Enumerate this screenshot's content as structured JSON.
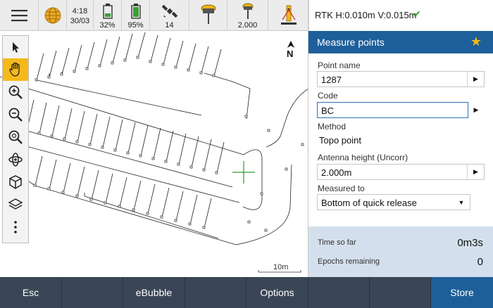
{
  "statusbar": {
    "menu_icon": "hamburger-menu-icon",
    "time": "4:18",
    "date": "30/03",
    "battery1": "32%",
    "battery2": "95%",
    "satellites": "14",
    "target_height": "2.000",
    "rtk": "RTK H:0.010m V:0.015m",
    "rtk_status_color": "#3aa035"
  },
  "map": {
    "north_label": "N",
    "scale_label": "10m",
    "tools": [
      "select-arrow-icon",
      "pan-hand-icon",
      "zoom-in-icon",
      "zoom-out-icon",
      "zoom-extents-icon",
      "orbit-icon",
      "cube-view-icon",
      "layers-icon",
      "more-dots-icon"
    ]
  },
  "panel": {
    "title": "Measure points",
    "point_name_label": "Point name",
    "point_name_value": "1287",
    "code_label": "Code",
    "code_value": "BC",
    "method_label": "Method",
    "method_value": "Topo point",
    "antenna_label": "Antenna height (Uncorr)",
    "antenna_value": "2.000m",
    "measured_to_label": "Measured to",
    "measured_to_value": "Bottom of quick release",
    "time_label": "Time so far",
    "time_value": "0m3s",
    "epochs_label": "Epochs remaining",
    "epochs_value": "0"
  },
  "bottombar": {
    "esc": "Esc",
    "ebubble": "eBubble",
    "options": "Options",
    "store": "Store"
  },
  "colors": {
    "accent": "#1d5f9a",
    "active_tool": "#f5b91a",
    "bottom_bar": "#3a4656",
    "crosshair": "#2a9a2a"
  }
}
